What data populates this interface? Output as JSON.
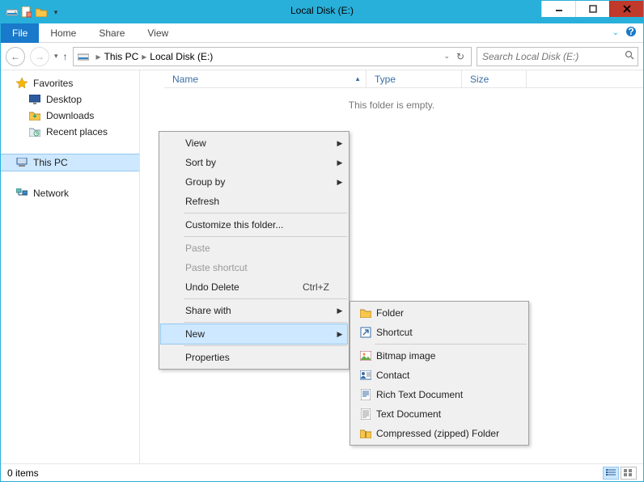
{
  "window": {
    "title": "Local Disk (E:)"
  },
  "ribbon": {
    "file": "File",
    "home": "Home",
    "share": "Share",
    "view": "View"
  },
  "breadcrumb": {
    "root": "This PC",
    "leaf": "Local Disk (E:)"
  },
  "search": {
    "placeholder": "Search Local Disk (E:)"
  },
  "navpane": {
    "favorites": {
      "label": "Favorites",
      "items": [
        {
          "label": "Desktop"
        },
        {
          "label": "Downloads"
        },
        {
          "label": "Recent places"
        }
      ]
    },
    "thispc": {
      "label": "This PC"
    },
    "network": {
      "label": "Network"
    }
  },
  "columns": {
    "name": "Name",
    "type": "Type",
    "size": "Size"
  },
  "empty_message": "This folder is empty.",
  "context_menu": {
    "view": "View",
    "sort_by": "Sort by",
    "group_by": "Group by",
    "refresh": "Refresh",
    "customize": "Customize this folder...",
    "paste": "Paste",
    "paste_shortcut": "Paste shortcut",
    "undo_delete": "Undo Delete",
    "undo_delete_shortcut": "Ctrl+Z",
    "share_with": "Share with",
    "new": "New",
    "properties": "Properties"
  },
  "new_submenu": {
    "folder": "Folder",
    "shortcut": "Shortcut",
    "bitmap": "Bitmap image",
    "contact": "Contact",
    "rtf": "Rich Text Document",
    "txt": "Text Document",
    "zip": "Compressed (zipped) Folder"
  },
  "status": {
    "items": "0 items"
  }
}
